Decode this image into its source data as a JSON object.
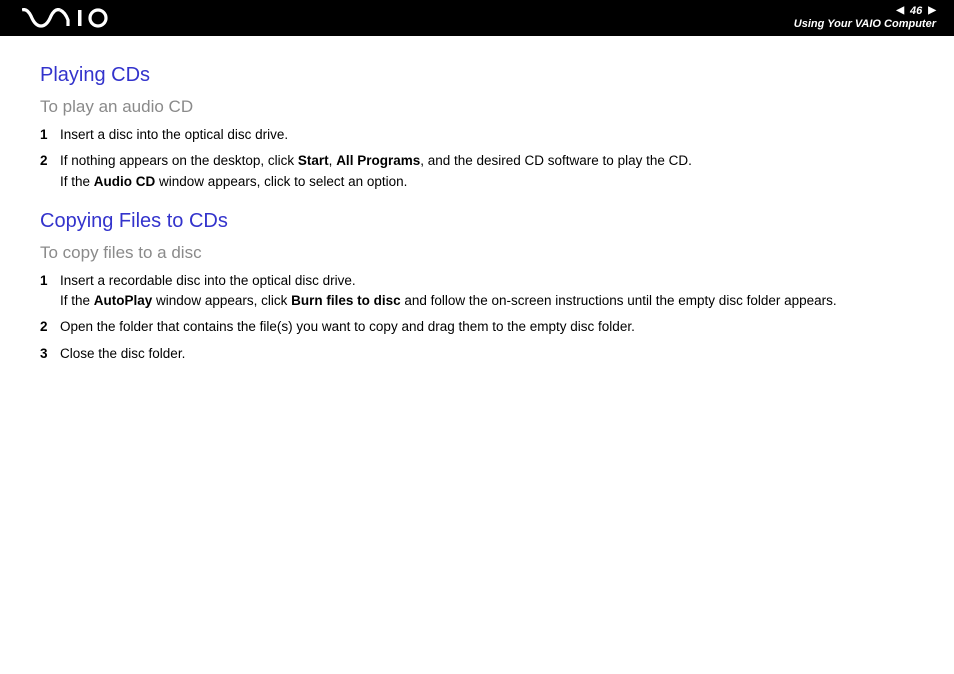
{
  "header": {
    "page_number": "46",
    "section": "Using Your VAIO Computer"
  },
  "section1": {
    "title": "Playing CDs",
    "subtitle": "To play an audio CD",
    "steps": [
      {
        "num": "1",
        "html": "Insert a disc into the optical disc drive."
      },
      {
        "num": "2",
        "html": "If nothing appears on the desktop, click <b>Start</b>, <b>All Programs</b>, and the desired CD software to play the CD.<br>If the <b>Audio CD</b> window appears, click to select an option."
      }
    ]
  },
  "section2": {
    "title": "Copying Files to CDs",
    "subtitle": "To copy files to a disc",
    "steps": [
      {
        "num": "1",
        "html": "Insert a recordable disc into the optical disc drive.<br>If the <b>AutoPlay</b> window appears, click <b>Burn files to disc</b> and follow the on-screen instructions until the empty disc folder appears."
      },
      {
        "num": "2",
        "html": "Open the folder that contains the file(s) you want to copy and drag them to the empty disc folder."
      },
      {
        "num": "3",
        "html": "Close the disc folder."
      }
    ]
  }
}
